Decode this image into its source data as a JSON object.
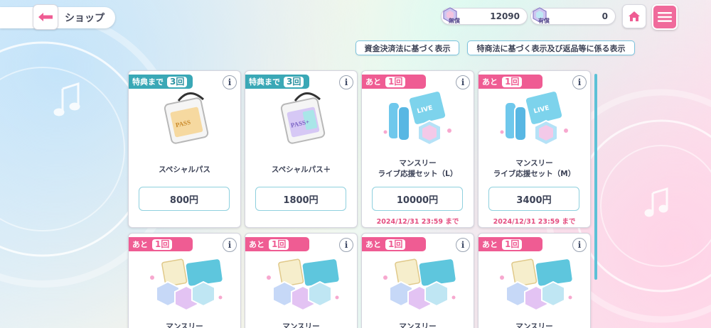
{
  "header": {
    "title": "ショップ",
    "free_currency": {
      "label": "無償",
      "value": "12090"
    },
    "paid_currency": {
      "label": "有償",
      "value": "0"
    }
  },
  "legal_links": [
    "資金決済法に基づく表示",
    "特商法に基づく表示及び返品等に係る表示"
  ],
  "colors": {
    "accent_pink": "#ef5c93",
    "accent_teal": "#3aa8b6"
  },
  "products": [
    {
      "badge_pre": "特典まで",
      "badge_count": "3",
      "badge_unit": "回",
      "name_line1": "スペシャルパス",
      "name_line2": "",
      "price": "800円",
      "deadline": "",
      "icon": "special-pass-icon"
    },
    {
      "badge_pre": "特典まで",
      "badge_count": "3",
      "badge_unit": "回",
      "name_line1": "スペシャルパス＋",
      "name_line2": "",
      "price": "1800円",
      "deadline": "",
      "icon": "special-pass-plus-icon"
    },
    {
      "badge_pre": "あと",
      "badge_count": "1",
      "badge_unit": "回",
      "name_line1": "マンスリー",
      "name_line2": "ライブ応援セット（L）",
      "price": "10000円",
      "deadline": "2024/12/31 23:59 まで",
      "icon": "live-support-set-icon"
    },
    {
      "badge_pre": "あと",
      "badge_count": "1",
      "badge_unit": "回",
      "name_line1": "マンスリー",
      "name_line2": "ライブ応援セット（M）",
      "price": "3400円",
      "deadline": "2024/12/31 23:59 まで",
      "icon": "live-support-set-icon"
    },
    {
      "badge_pre": "あと",
      "badge_count": "1",
      "badge_unit": "回",
      "name_line1": "マンスリー",
      "icon": "gacha-gem-set-icon"
    },
    {
      "badge_pre": "あと",
      "badge_count": "1",
      "badge_unit": "回",
      "name_line1": "マンスリー",
      "icon": "gacha-gem-set-icon"
    },
    {
      "badge_pre": "あと",
      "badge_count": "1",
      "badge_unit": "回",
      "name_line1": "マンスリー",
      "icon": "gacha-gem-set-icon"
    },
    {
      "badge_pre": "あと",
      "badge_count": "1",
      "badge_unit": "回",
      "name_line1": "マンスリー",
      "icon": "gacha-gem-set-icon"
    }
  ],
  "info_label": "i"
}
